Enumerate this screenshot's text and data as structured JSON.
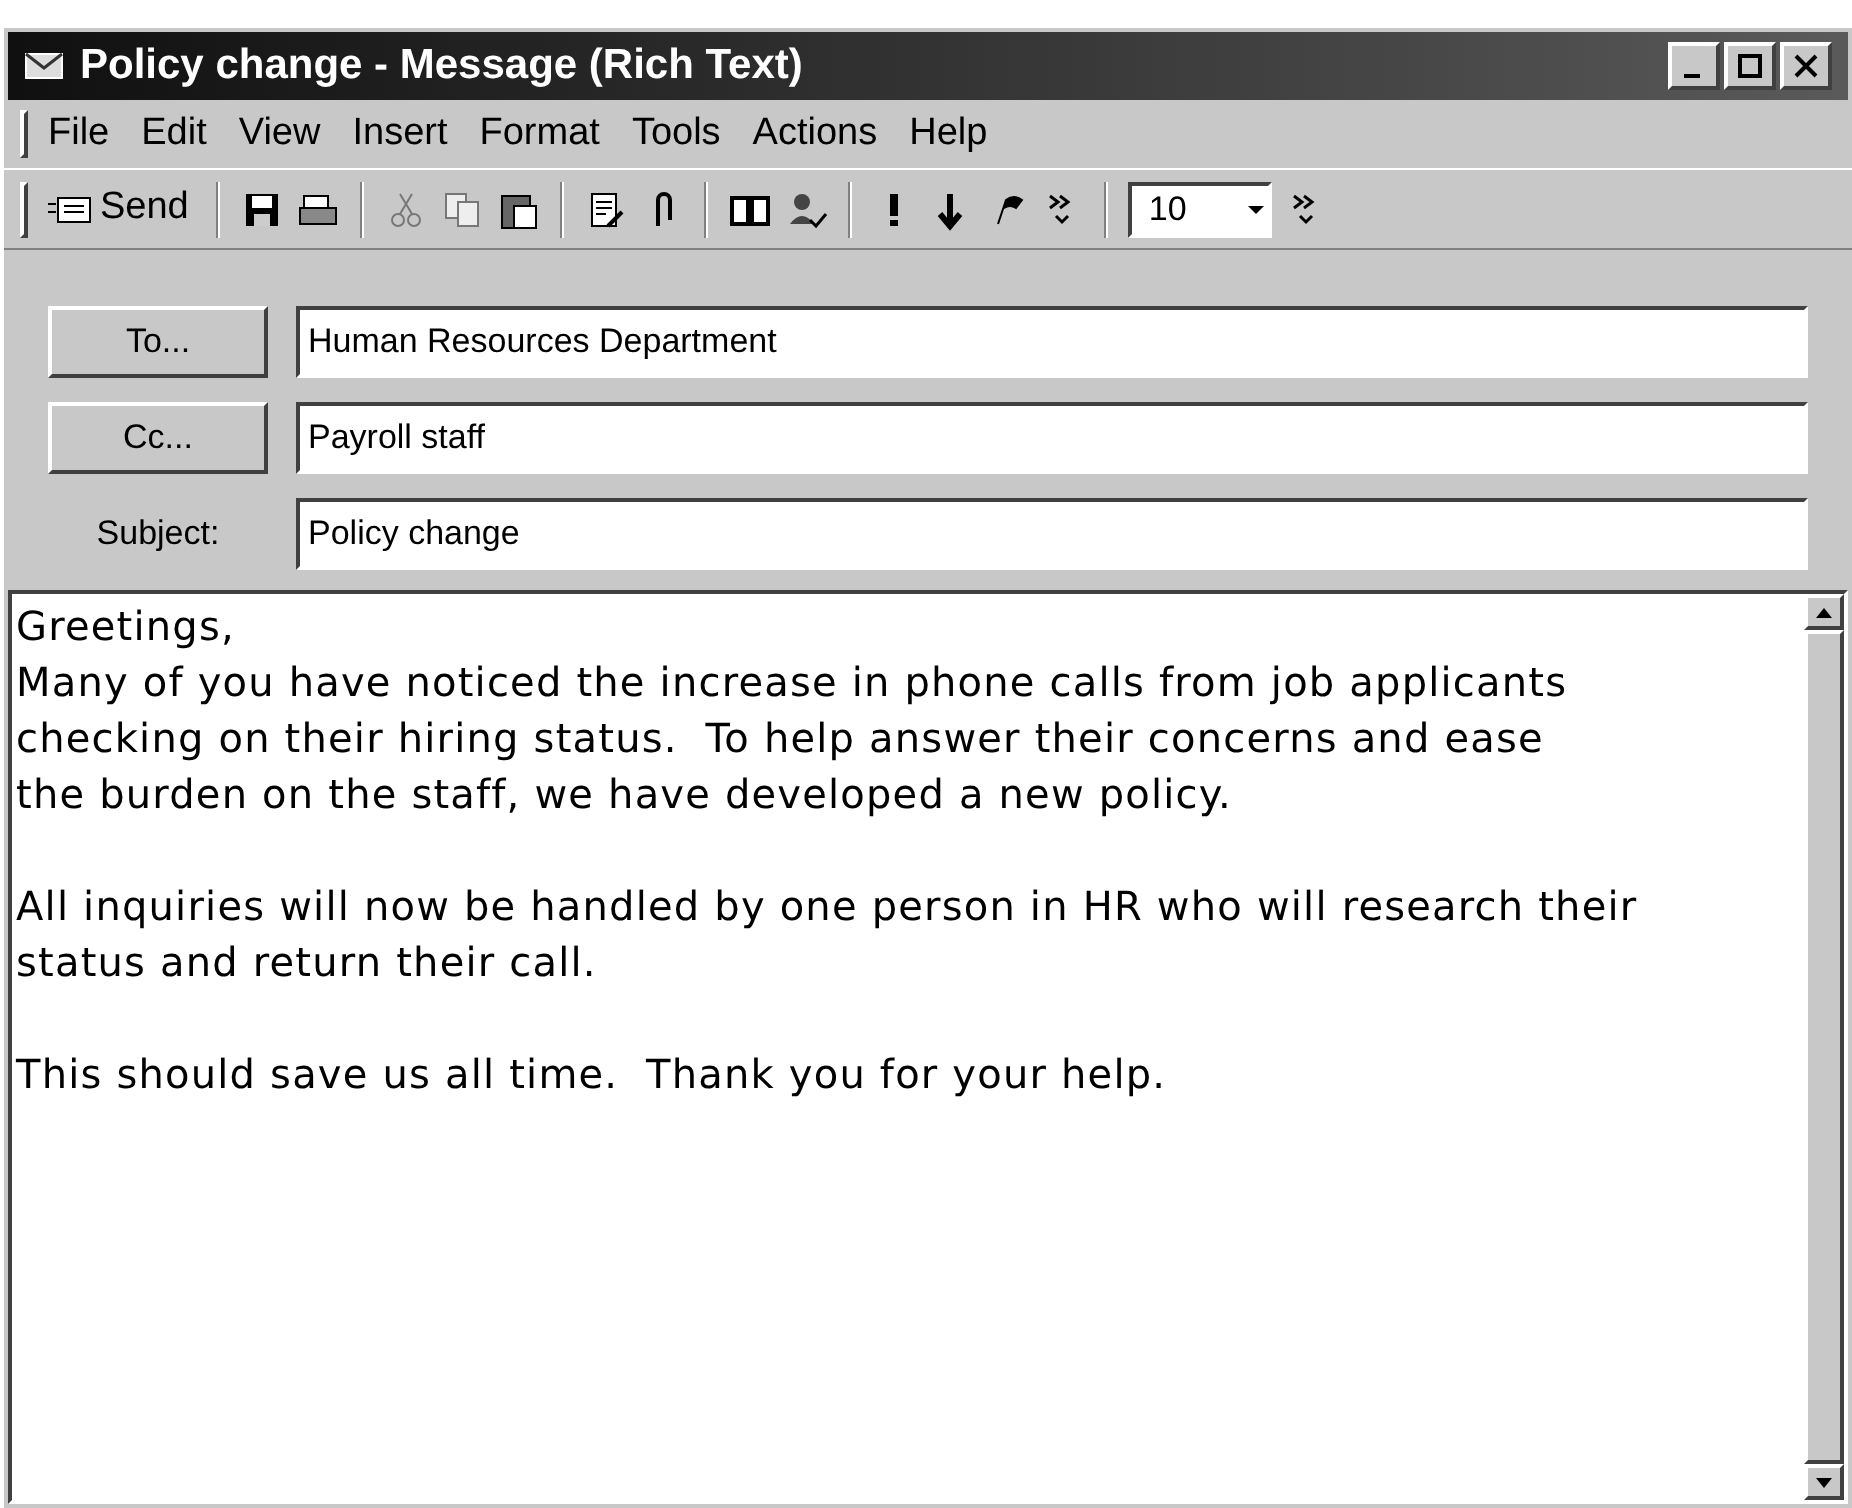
{
  "window": {
    "title": "Policy change - Message (Rich Text)"
  },
  "menu": [
    "File",
    "Edit",
    "View",
    "Insert",
    "Format",
    "Tools",
    "Actions",
    "Help"
  ],
  "toolbar": {
    "send": "Send",
    "font_size": "10"
  },
  "fields": [
    {
      "kind": "button",
      "label": "To...",
      "value": "Human Resources Department"
    },
    {
      "kind": "button",
      "label": "Cc...",
      "value": "Payroll staff"
    },
    {
      "kind": "label",
      "label": "Subject:",
      "value": "Policy change"
    }
  ],
  "body": [
    {
      "lines": [
        "Greetings,",
        "Many of you have noticed the increase in phone calls from job applicants",
        "checking on their hiring status.  To help answer their concerns and ease",
        "the burden on the staff, we have developed a new policy."
      ]
    },
    {
      "lines": [
        "All inquiries will now be handled by one person in HR who will research their",
        "status and return their call."
      ]
    },
    {
      "lines": [
        "This should save us all time.  Thank you for your help."
      ]
    }
  ]
}
